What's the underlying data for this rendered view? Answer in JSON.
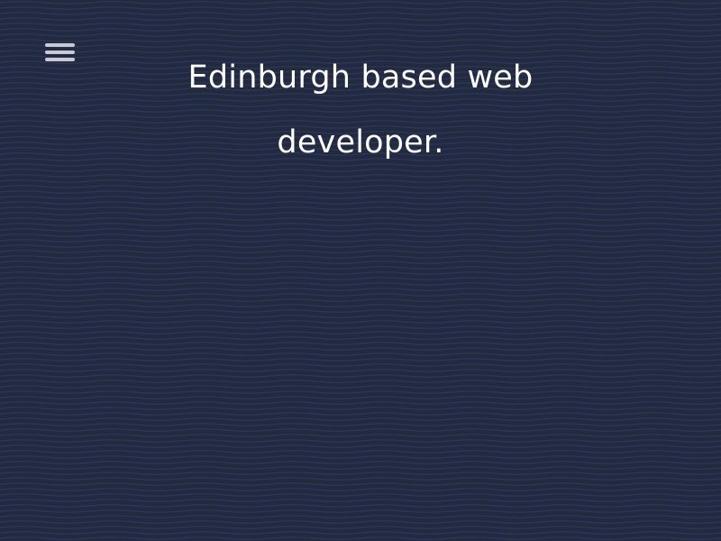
{
  "header": {
    "menu_icon": "hamburger-menu-icon",
    "headline": "Edinburgh based web developer."
  },
  "colors": {
    "background": "#222a3d",
    "wave_line": "#2d3560",
    "text": "#ffffff",
    "menu_icon": "#c8cad6"
  }
}
